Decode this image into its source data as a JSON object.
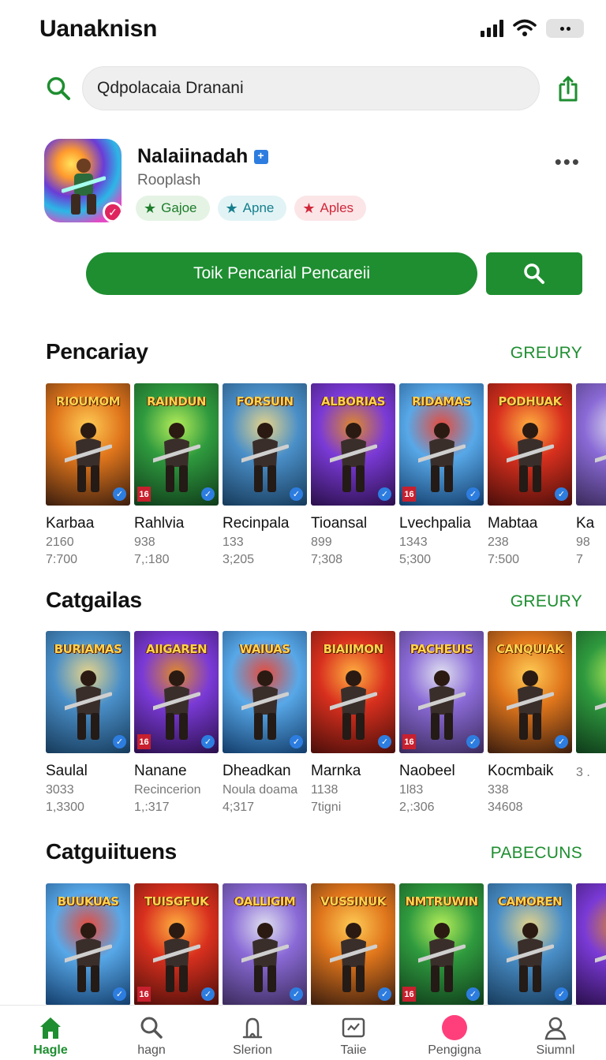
{
  "status_bar": {
    "title": "Uanaknisn"
  },
  "search": {
    "value": "Qdpolacaia Dranani"
  },
  "app": {
    "name": "Nalaiinadah",
    "developer": "Rooplash",
    "chips": [
      {
        "label": "Gajoe",
        "color": "#1d7d2a"
      },
      {
        "label": "Apne",
        "color": "#157f8c"
      },
      {
        "label": "Aples",
        "color": "#d0283a"
      }
    ]
  },
  "cta": {
    "label": "Toik Pencarial Pencareii"
  },
  "sections": [
    {
      "title": "Pencariay",
      "link": "GREURY",
      "items": [
        {
          "title_art": "RIOUMOM",
          "name": "Karbaa",
          "line1": "2160",
          "line2": "7:700"
        },
        {
          "title_art": "RAINDUN",
          "name": "Rahlvia",
          "line1": "938",
          "line2": "7,:180"
        },
        {
          "title_art": "FORSUIN",
          "name": "Recinpala",
          "line1": "133",
          "line2": "3;205"
        },
        {
          "title_art": "ALBORIAS",
          "name": "Tioansal",
          "line1": "899",
          "line2": "7;308"
        },
        {
          "title_art": "RIDAMAS",
          "name": "Lvechpalia",
          "line1": "1343",
          "line2": "5;300"
        },
        {
          "title_art": "PODHUAK",
          "name": "Mabtaa",
          "line1": "238",
          "line2": "7:500"
        },
        {
          "title_art": "",
          "name": "Ka",
          "line1": "98",
          "line2": "7"
        }
      ]
    },
    {
      "title": "Catgailas",
      "link": "GREURY",
      "items": [
        {
          "title_art": "BURIAMAS",
          "name": "Saulal",
          "line1": "3033",
          "line2": "1,3300"
        },
        {
          "title_art": "AIIGAREN",
          "name": "Nanane",
          "line1": "Recincerion",
          "line2": "1,:317"
        },
        {
          "title_art": "WAIUAS",
          "name": "Dheadkan",
          "line1": "Noula doama",
          "line2": "4;317"
        },
        {
          "title_art": "BIAIIMON",
          "name": "Marnka",
          "line1": "1138",
          "line2": "7tigni"
        },
        {
          "title_art": "PACHEUIS",
          "name": "Naobeel",
          "line1": "1l83",
          "line2": "2,:306"
        },
        {
          "title_art": "CANQUIAK",
          "name": "Kocmbaik",
          "line1": "338",
          "line2": "34608"
        },
        {
          "title_art": "",
          "name": "",
          "line1": "",
          "line2": "3 ."
        }
      ]
    },
    {
      "title": "Catguiituens",
      "link": "PABECUNS",
      "items": [
        {
          "title_art": "BUUKUAS",
          "name": "",
          "line1": "",
          "line2": ""
        },
        {
          "title_art": "TUISGFUK",
          "name": "",
          "line1": "",
          "line2": ""
        },
        {
          "title_art": "OALLIGIM",
          "name": "",
          "line1": "",
          "line2": ""
        },
        {
          "title_art": "VUSSINUK",
          "name": "",
          "line1": "",
          "line2": ""
        },
        {
          "title_art": "NMTRUWIN",
          "name": "",
          "line1": "",
          "line2": ""
        },
        {
          "title_art": "CAMOREN",
          "name": "",
          "line1": "",
          "line2": ""
        },
        {
          "title_art": "",
          "name": "",
          "line1": "",
          "line2": ""
        }
      ]
    }
  ],
  "bottom_nav": [
    {
      "label": "Hagle",
      "icon": "home-icon",
      "active": true
    },
    {
      "label": "hagn",
      "icon": "search-icon",
      "active": false
    },
    {
      "label": "Slerion",
      "icon": "bell-icon",
      "active": false
    },
    {
      "label": "Taiie",
      "icon": "tv-icon",
      "active": false
    },
    {
      "label": "Pengigna",
      "icon": "dot-icon",
      "active": false
    },
    {
      "label": "Siumnl",
      "icon": "profile-icon",
      "active": false
    }
  ],
  "colors": {
    "accent": "#1e8e30",
    "link": "#1e8e30"
  }
}
